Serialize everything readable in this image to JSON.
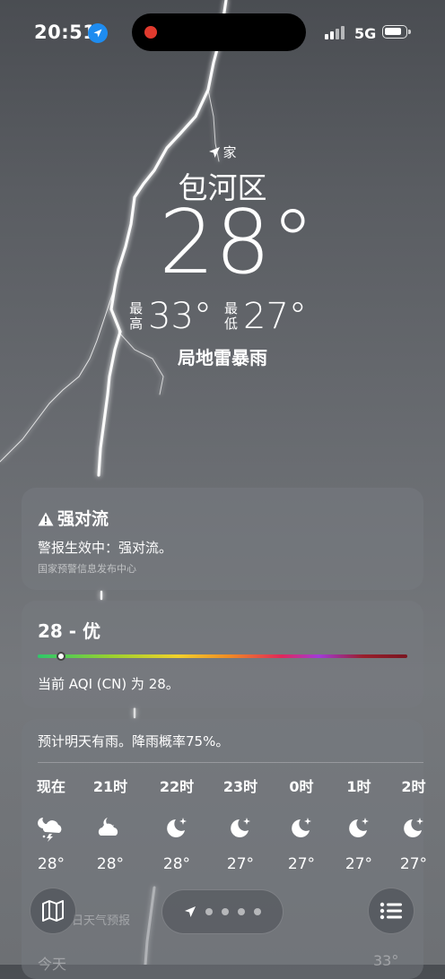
{
  "status_bar": {
    "time": "20:51",
    "network": "5G",
    "location_icon": "location-arrow-icon"
  },
  "header": {
    "home_label": "家",
    "city": "包河区",
    "temperature": "28°",
    "high_label": [
      "最",
      "高"
    ],
    "high": "33°",
    "low_label": [
      "最",
      "低"
    ],
    "low": "27°",
    "condition": "局地雷暴雨"
  },
  "alert": {
    "title": "强对流",
    "body": "警报生效中：强对流。",
    "source": "国家预警信息发布中心",
    "icon": "warning-triangle-icon"
  },
  "aqi": {
    "value": "28 - 优",
    "level_fraction": 0.06,
    "description": "当前 AQI (CN) 为 28。"
  },
  "hourly": {
    "summary": "预计明天有雨。降雨概率75%。",
    "items": [
      {
        "time": "现在",
        "icon": "thunderstorm-night-icon",
        "temp": "28°"
      },
      {
        "time": "21时",
        "icon": "partly-cloudy-night-icon",
        "temp": "28°"
      },
      {
        "time": "22时",
        "icon": "clear-night-icon",
        "temp": "28°"
      },
      {
        "time": "23时",
        "icon": "clear-night-icon",
        "temp": "27°"
      },
      {
        "time": "0时",
        "icon": "clear-night-icon",
        "temp": "27°"
      },
      {
        "time": "1时",
        "icon": "clear-night-icon",
        "temp": "27°"
      },
      {
        "time": "2时",
        "icon": "clear-night-icon",
        "temp": "27°"
      }
    ]
  },
  "behind_text": {
    "daily_title": "日天气预报",
    "today": "今天",
    "today_high": "33°"
  },
  "toolbar": {
    "map_icon": "map-icon",
    "list_icon": "list-icon",
    "page_count": 4
  },
  "colors": {
    "location_blue": "#1e8cf0",
    "recording_red": "#e03a2e"
  }
}
